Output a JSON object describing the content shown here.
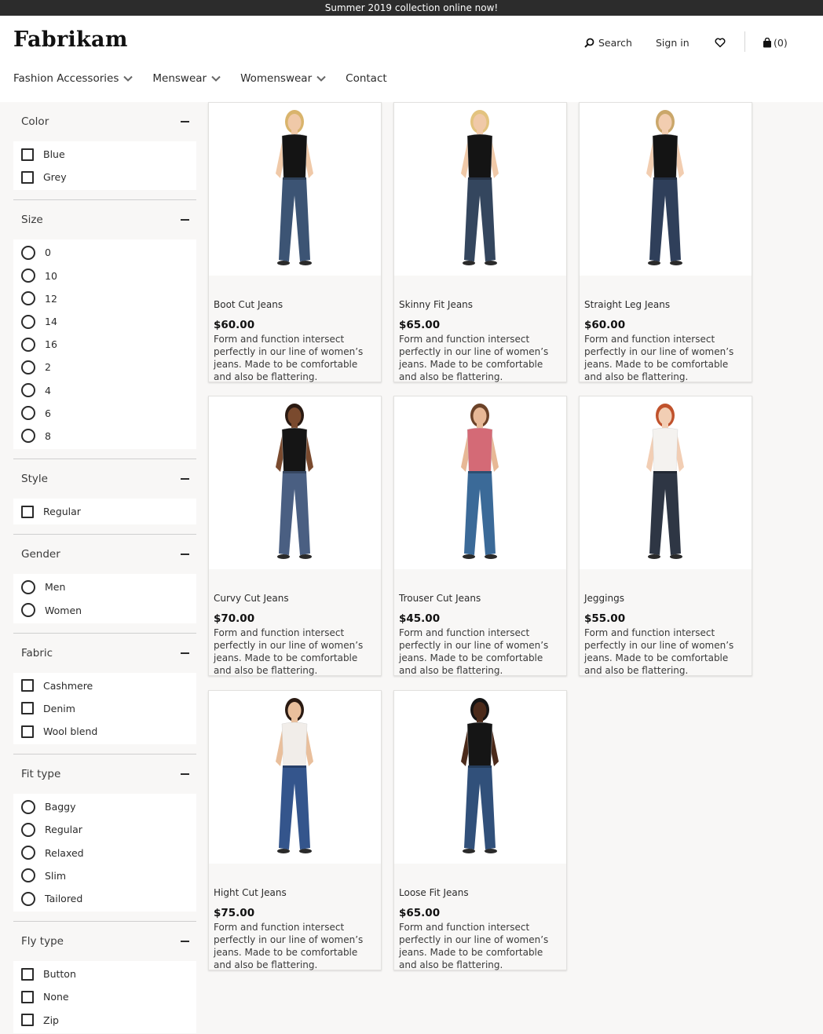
{
  "banner": {
    "text": "Summer 2019 collection online now!"
  },
  "header": {
    "logo": "Fabrikam",
    "search_label": "Search",
    "signin_label": "Sign in",
    "cart_label": "(0)"
  },
  "nav": {
    "items": [
      {
        "label": "Fashion Accessories"
      },
      {
        "label": "Menswear"
      },
      {
        "label": "Womenswear"
      },
      {
        "label": "Contact"
      }
    ]
  },
  "filters": {
    "color": {
      "title": "Color",
      "options": [
        "Blue",
        "Grey"
      ]
    },
    "size": {
      "title": "Size",
      "options": [
        "0",
        "10",
        "12",
        "14",
        "16",
        "2",
        "4",
        "6",
        "8"
      ]
    },
    "style": {
      "title": "Style",
      "options": [
        "Regular"
      ]
    },
    "gender": {
      "title": "Gender",
      "options": [
        "Men",
        "Women"
      ]
    },
    "fabric": {
      "title": "Fabric",
      "options": [
        "Cashmere",
        "Denim",
        "Wool blend"
      ]
    },
    "fit": {
      "title": "Fit type",
      "options": [
        "Baggy",
        "Regular",
        "Relaxed",
        "Slim",
        "Tailored"
      ]
    },
    "fly": {
      "title": "Fly type",
      "options": [
        "Button",
        "None",
        "Zip"
      ]
    }
  },
  "products": [
    {
      "name": "Boot Cut Jeans",
      "price": "$60.00",
      "description": "Form and function intersect perfectly in our line of women’s jeans. Made to be comfortable and also be flattering.",
      "top_color": "#141414",
      "skin": "#f0c9a8",
      "hair": "#d9b46c",
      "jeans": "#3c5474"
    },
    {
      "name": "Skinny Fit Jeans",
      "price": "$65.00",
      "description": "Form and function intersect perfectly in our line of women’s jeans. Made to be comfortable and also be flattering.",
      "top_color": "#141414",
      "skin": "#f0c9a8",
      "hair": "#e3c37f",
      "jeans": "#34465e"
    },
    {
      "name": "Straight Leg Jeans",
      "price": "$60.00",
      "description": "Form and function intersect perfectly in our line of women’s jeans. Made to be comfortable and also be flattering.",
      "top_color": "#141414",
      "skin": "#f2cdb0",
      "hair": "#caa76a",
      "jeans": "#2f3f5a"
    },
    {
      "name": "Curvy Cut Jeans",
      "price": "$70.00",
      "description": "Form and function intersect perfectly in our line of women’s jeans. Made to be comfortable and also be flattering.",
      "top_color": "#151515",
      "skin": "#7a4a2e",
      "hair": "#2a1a12",
      "jeans": "#4a5f82"
    },
    {
      "name": "Trouser Cut Jeans",
      "price": "$45.00",
      "description": "Form and function intersect perfectly in our line of women’s jeans. Made to be comfortable and also be flattering.",
      "top_color": "#d46a76",
      "skin": "#e7b896",
      "hair": "#6b4228",
      "jeans": "#3b6a98"
    },
    {
      "name": "Jeggings",
      "price": "$55.00",
      "description": "Form and function intersect perfectly in our line of women’s jeans. Made to be comfortable and also be flattering.",
      "top_color": "#f4f2ef",
      "skin": "#f2ceb4",
      "hair": "#c0522c",
      "jeans": "#2e3644"
    },
    {
      "name": "Hight Cut Jeans",
      "price": "$75.00",
      "description": "Form and function intersect perfectly in our line of women’s jeans. Made to be comfortable and also be flattering.",
      "top_color": "#f1ede9",
      "skin": "#e9bf9c",
      "hair": "#2a1a12",
      "jeans": "#34558c"
    },
    {
      "name": "Loose Fit Jeans",
      "price": "$65.00",
      "description": "Form and function intersect perfectly in our line of women’s jeans. Made to be comfortable and also be flattering.",
      "top_color": "#151515",
      "skin": "#4b2a1a",
      "hair": "#141414",
      "jeans": "#31507a"
    }
  ]
}
